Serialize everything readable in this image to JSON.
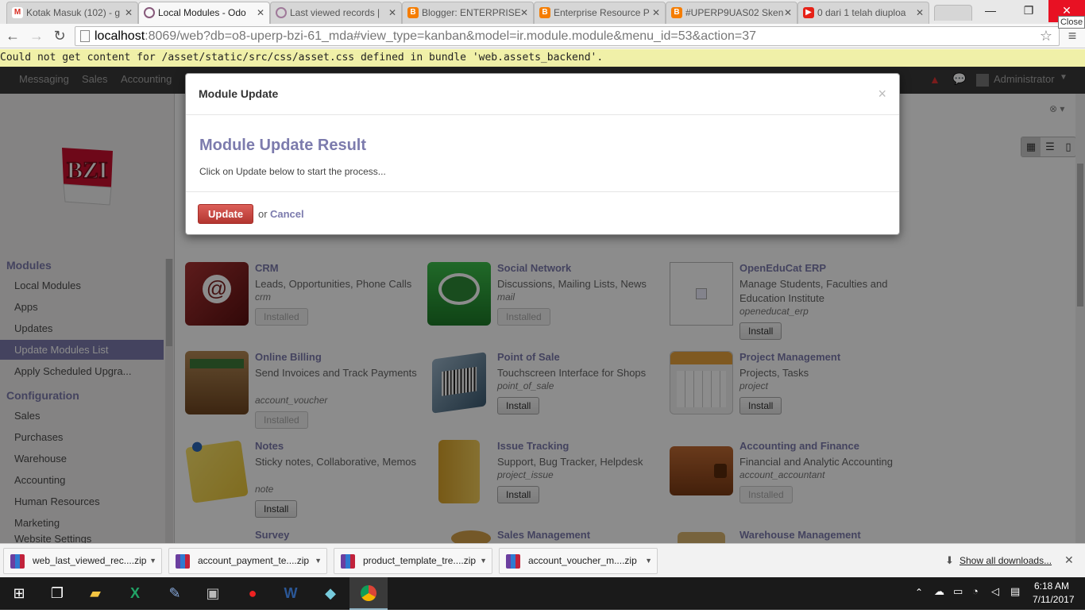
{
  "browser": {
    "tabs": [
      {
        "label": "Kotak Masuk (102) - g",
        "icon": "gmail-icon",
        "color": "#d93025"
      },
      {
        "label": "Local Modules - Odo",
        "icon": "odoo-icon",
        "color": "#875a7b"
      },
      {
        "label": "Last viewed records |",
        "icon": "odoo-icon",
        "color": "#875a7b"
      },
      {
        "label": "Blogger: ENTERPRISE",
        "icon": "blogger-icon",
        "color": "#f57d00"
      },
      {
        "label": "Enterprise Resource P",
        "icon": "blogger-icon",
        "color": "#f57d00"
      },
      {
        "label": "#UPERP9UAS02 Sken",
        "icon": "blogger-icon",
        "color": "#f57d00"
      },
      {
        "label": "0 dari 1 telah diuploa",
        "icon": "youtube-icon",
        "color": "#e62117"
      }
    ],
    "close_tooltip": "Close",
    "url_host": "localhost",
    "url_rest": ":8069/web?db=o8-uperp-bzi-61_mda#view_type=kanban&model=ir.module.module&menu_id=53&action=37"
  },
  "error_text": "Could not get content for /asset/static/src/css/asset.css defined in bundle 'web.assets_backend'.",
  "topbar": {
    "menus": [
      "Messaging",
      "Sales",
      "Accounting"
    ],
    "user": "Administrator"
  },
  "sidebar": {
    "logo": "BZI",
    "sections": [
      {
        "title": "Modules",
        "items": [
          "Local Modules",
          "Apps",
          "Updates",
          "Update Modules List",
          "Apply Scheduled Upgra..."
        ]
      },
      {
        "title": "Configuration",
        "items": [
          "Sales",
          "Purchases",
          "Warehouse",
          "Accounting",
          "Human Resources",
          "Marketing",
          "Website Settings"
        ]
      }
    ],
    "selected": "Update Modules List"
  },
  "modules": [
    {
      "title": "CRM",
      "desc": "Leads, Opportunities, Phone Calls",
      "tech": "crm",
      "button": "Installed",
      "installed": true,
      "icon": "address-book-icon",
      "color": "#7a1f1f"
    },
    {
      "title": "Social Network",
      "desc": "Discussions, Mailing Lists, News",
      "tech": "mail",
      "button": "Installed",
      "installed": true,
      "icon": "chat-bubble-icon",
      "color": "#2e9e3a"
    },
    {
      "title": "OpenEduCat ERP",
      "desc": "Manage Students, Faculties and Education Institute",
      "tech": "openeducat_erp",
      "button": "Install",
      "installed": false,
      "icon": "broken-image-icon",
      "color": "#ffffff"
    },
    {
      "title": "Online Billing",
      "desc": "Send Invoices and Track Payments",
      "tech": "account_voucher",
      "button": "Installed",
      "installed": true,
      "icon": "wallet-icon",
      "color": "#8b5a2b"
    },
    {
      "title": "Point of Sale",
      "desc": "Touchscreen Interface for Shops",
      "tech": "point_of_sale",
      "button": "Install",
      "installed": false,
      "icon": "barcode-icon",
      "color": "#4a6f8a"
    },
    {
      "title": "Project Management",
      "desc": "Projects, Tasks",
      "tech": "project",
      "button": "Install",
      "installed": false,
      "icon": "calendar-icon",
      "color": "#e8a33c"
    },
    {
      "title": "Notes",
      "desc": "Sticky notes, Collaborative, Memos",
      "tech": "note",
      "button": "Install",
      "installed": false,
      "icon": "sticky-note-icon",
      "color": "#f4d03f"
    },
    {
      "title": "Issue Tracking",
      "desc": "Support, Bug Tracker, Helpdesk",
      "tech": "project_issue",
      "button": "Install",
      "installed": false,
      "icon": "folder-icon",
      "color": "#e6b53a"
    },
    {
      "title": "Accounting and Finance",
      "desc": "Financial and Analytic Accounting",
      "tech": "account_accountant",
      "button": "Installed",
      "installed": true,
      "icon": "wallet-icon",
      "color": "#a0522d"
    },
    {
      "title": "Survey",
      "desc": "",
      "tech": "",
      "button": "",
      "installed": false,
      "icon": "survey-icon",
      "color": "#dddddd"
    },
    {
      "title": "Sales Management",
      "desc": "",
      "tech": "",
      "button": "",
      "installed": false,
      "icon": "coins-icon",
      "color": "#d4a04a"
    },
    {
      "title": "Warehouse Management",
      "desc": "",
      "tech": "",
      "button": "",
      "installed": false,
      "icon": "box-icon",
      "color": "#d9b56f"
    }
  ],
  "modal": {
    "title": "Module Update",
    "result_title": "Module Update Result",
    "message": "Click on Update below to start the process...",
    "update_label": "Update",
    "or_label": "or",
    "cancel_label": "Cancel",
    "close_symbol": "×"
  },
  "downloads": {
    "items": [
      "web_last_viewed_rec....zip",
      "account_payment_te....zip",
      "product_template_tre....zip",
      "account_voucher_m....zip"
    ],
    "show_all": "Show all downloads..."
  },
  "taskbar": {
    "time": "6:18 AM",
    "date": "7/11/2017"
  }
}
